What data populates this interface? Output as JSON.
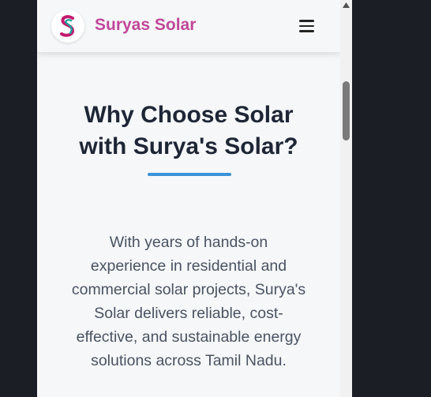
{
  "navbar": {
    "brand": "Suryas Solar",
    "logo_letter": "S",
    "menu_icon": "hamburger-menu-icon"
  },
  "hero": {
    "heading_line1": "Why Choose Solar",
    "heading_line2": "with Surya's Solar?",
    "paragraph_line1": "With years of hands-on",
    "paragraph_line2": "experience in residential and",
    "paragraph_line3": "commercial solar projects, Surya's",
    "paragraph_line4": "Solar delivers reliable, cost-",
    "paragraph_line5": "effective, and sustainable energy",
    "paragraph_line6": "solutions across Tamil Nadu."
  },
  "colors": {
    "brand": "#c0479a",
    "accent_line": "#3b93d9",
    "heading": "#1e2636",
    "body_text": "#4a5362",
    "page_bg": "#f5f7f9",
    "outer_bg": "#1c1e26"
  },
  "scrollbar": {
    "scroll_position": 0.22
  }
}
